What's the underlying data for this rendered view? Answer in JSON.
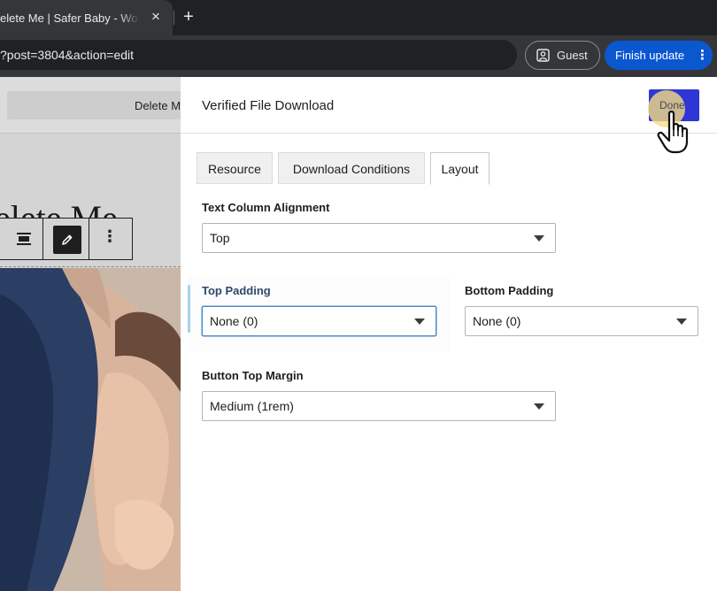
{
  "browser": {
    "tab_title": "elete Me | Safer Baby - Word",
    "tab_close": "×",
    "new_tab": "+",
    "url": "?post=3804&action=edit",
    "guest_label": "Guest",
    "finish_label": "Finish update",
    "finish_menu": "⋮"
  },
  "canvas": {
    "title_pill": "Delete Me",
    "heading": "elete Me",
    "more_label": "⋮"
  },
  "panel": {
    "title": "Verified File Download",
    "done_label": "Done",
    "tabs": [
      {
        "label": "Resource",
        "active": false
      },
      {
        "label": "Download Conditions",
        "active": false
      },
      {
        "label": "Layout",
        "active": true
      }
    ],
    "fields": {
      "text_column_alignment": {
        "label": "Text Column Alignment",
        "value": "Top"
      },
      "top_padding": {
        "label": "Top Padding",
        "value": "None (0)"
      },
      "bottom_padding": {
        "label": "Bottom Padding",
        "value": "None (0)"
      },
      "button_top_margin": {
        "label": "Button Top Margin",
        "value": "Medium (1rem)"
      }
    }
  },
  "colors": {
    "browser_bg": "#202124",
    "finish_button": "#0b57d0",
    "done_button": "#2f36d6",
    "focus_border": "#4b8cc8"
  }
}
